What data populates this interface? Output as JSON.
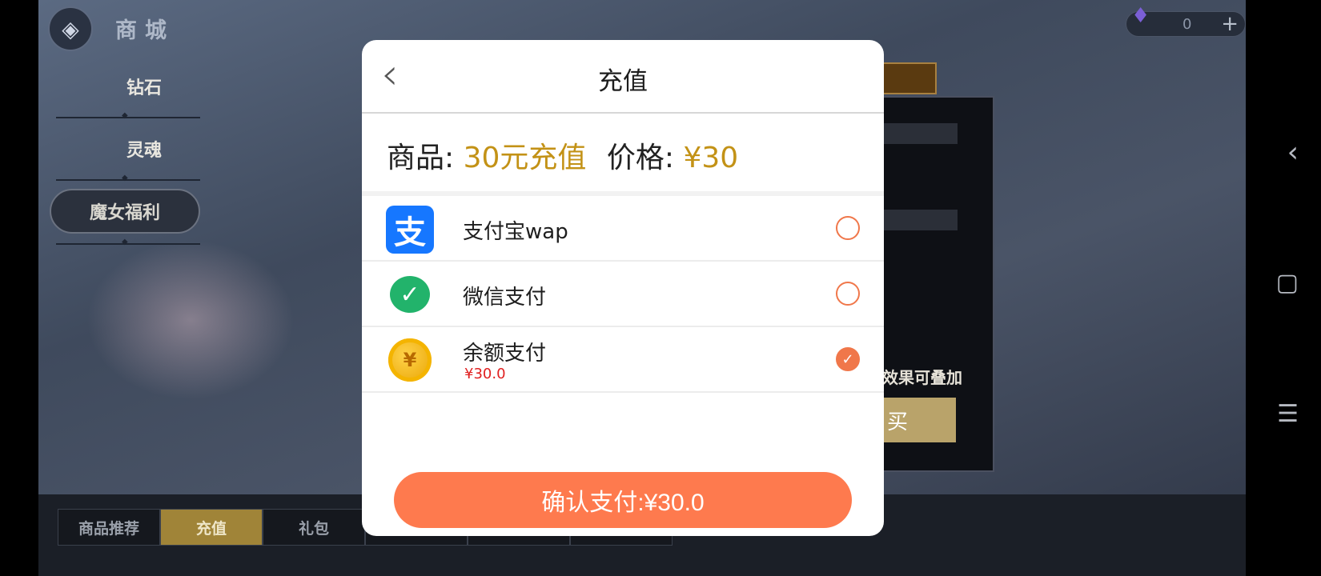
{
  "game": {
    "title": "商城",
    "categories": [
      "钻石",
      "灵魂",
      "魔女福利"
    ],
    "currency_amount": "0",
    "panel_text": "效果可叠加",
    "panel_button": "买",
    "tabs": [
      "商品推荐",
      "充值",
      "礼包"
    ],
    "active_tab": "充值"
  },
  "modal": {
    "title": "充值",
    "product_label": "商品:",
    "product_value": "30元充值",
    "price_label": "价格:",
    "price_value": "¥30",
    "payment_methods": [
      {
        "label": "支付宝wap",
        "icon": "alipay-icon",
        "selected": false
      },
      {
        "label": "微信支付",
        "icon": "wechat-icon",
        "selected": false
      },
      {
        "label": "余额支付",
        "icon": "coin-icon",
        "sub": "¥30.0",
        "selected": true
      }
    ],
    "confirm_label": "确认支付:¥30.0"
  },
  "colors": {
    "accent": "#fe7a4e",
    "gold": "#c39216",
    "balance_red": "#e02020"
  }
}
